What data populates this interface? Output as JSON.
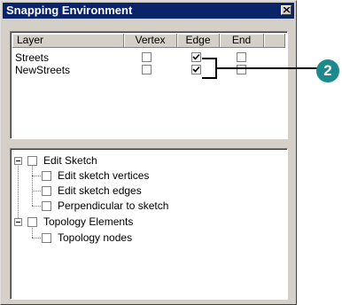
{
  "window": {
    "title": "Snapping Environment",
    "close_icon": "close-x-icon"
  },
  "snapping_table": {
    "columns": [
      "Layer",
      "Vertex",
      "Edge",
      "End"
    ],
    "rows": [
      {
        "layer": "Streets",
        "vertex": false,
        "edge": true,
        "end": false
      },
      {
        "layer": "NewStreets",
        "vertex": false,
        "edge": true,
        "end": false
      }
    ]
  },
  "tree": {
    "groups": [
      {
        "label": "Edit Sketch",
        "checked": false,
        "expanded": true,
        "children": [
          {
            "label": "Edit sketch vertices",
            "checked": false
          },
          {
            "label": "Edit sketch edges",
            "checked": false
          },
          {
            "label": "Perpendicular to sketch",
            "checked": false
          }
        ]
      },
      {
        "label": "Topology Elements",
        "checked": false,
        "expanded": true,
        "children": [
          {
            "label": "Topology nodes",
            "checked": false
          }
        ]
      }
    ]
  },
  "callout": {
    "number": "2",
    "color": "#1c8a8c"
  }
}
